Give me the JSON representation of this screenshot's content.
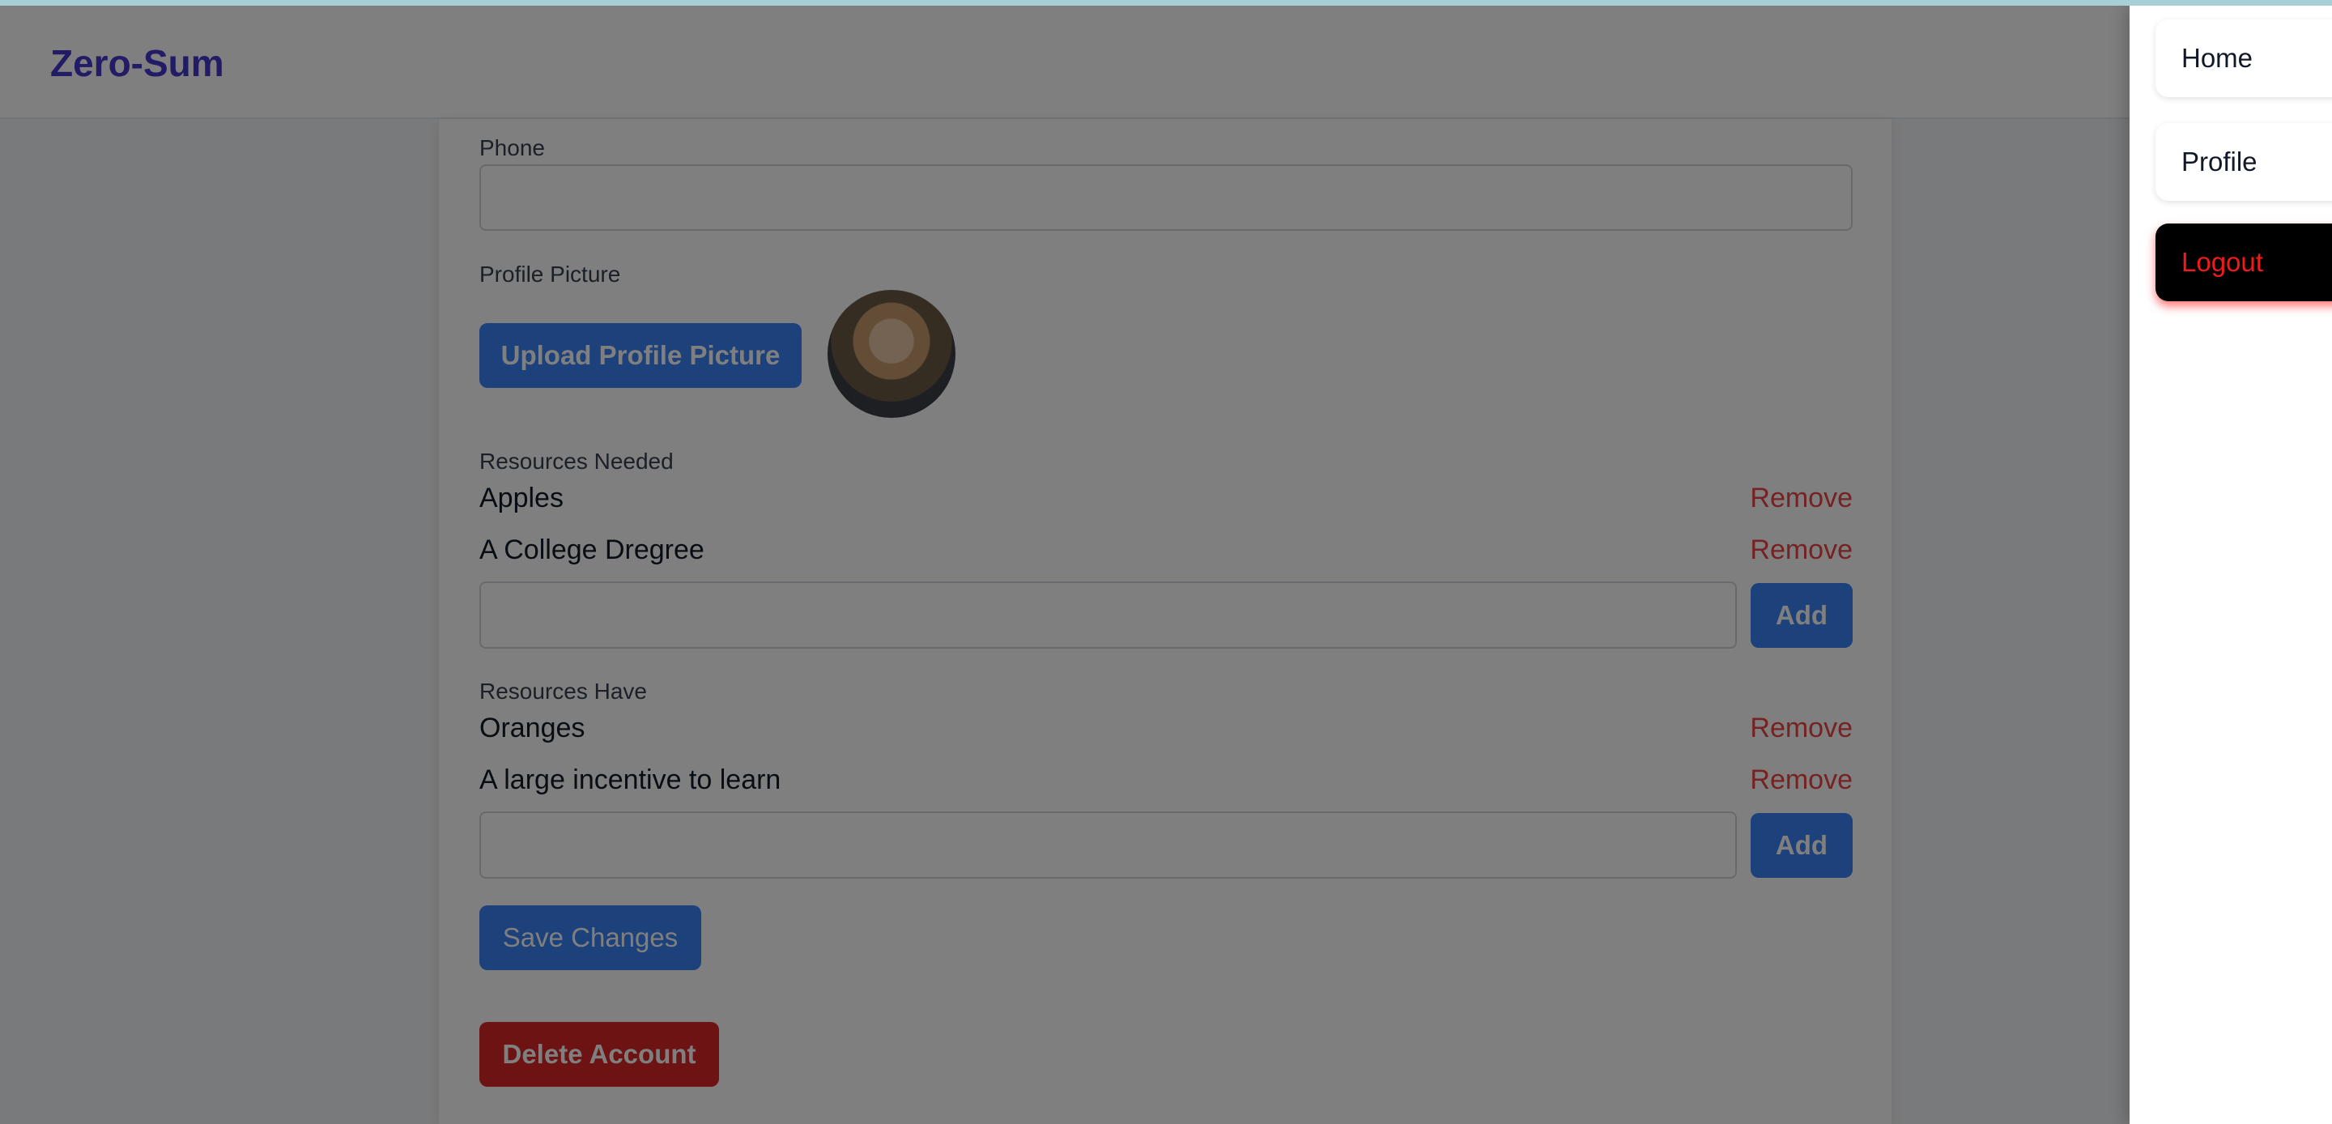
{
  "app": {
    "title": "Zero-Sum"
  },
  "form": {
    "phone": {
      "label": "Phone",
      "value": "",
      "placeholder": ""
    },
    "profile_picture": {
      "label": "Profile Picture",
      "upload_label": "Upload Profile Picture"
    },
    "resources_needed": {
      "label": "Resources Needed",
      "items": [
        "Apples",
        "A College Dregree"
      ],
      "remove_label": "Remove",
      "input_value": "",
      "add_label": "Add"
    },
    "resources_have": {
      "label": "Resources Have",
      "items": [
        "Oranges",
        "A large incentive to learn"
      ],
      "remove_label": "Remove",
      "input_value": "",
      "add_label": "Add"
    },
    "save_label": "Save Changes",
    "delete_label": "Delete Account"
  },
  "drawer": {
    "items": [
      {
        "label": "Home"
      },
      {
        "label": "Profile"
      },
      {
        "label": "Logout"
      }
    ]
  },
  "colors": {
    "brand": "#4338ca",
    "primary": "#3b82f6",
    "danger": "#dc2626",
    "logout_text": "#ef1a1a"
  }
}
